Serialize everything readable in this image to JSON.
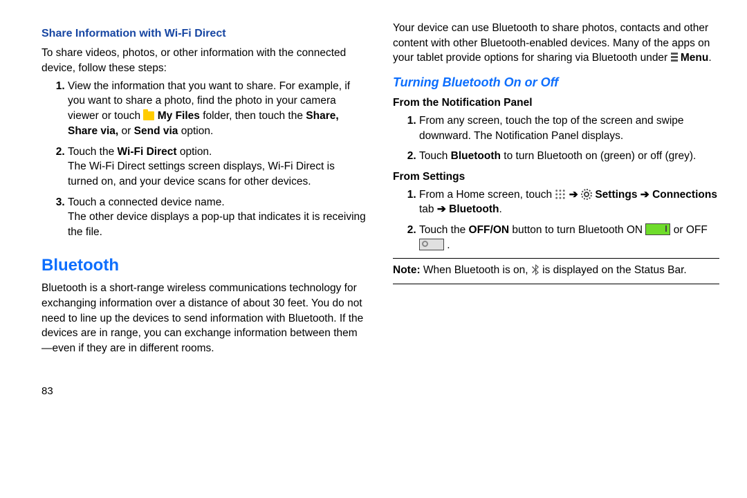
{
  "left": {
    "h_share": "Share Information with Wi-Fi Direct",
    "intro": "To share videos, photos, or other information with the connected device, follow these steps:",
    "step1_a": "View the information that you want to share. For example, if you want to share a photo, find the photo in your camera viewer or touch ",
    "step1_myfiles": " My Files",
    "step1_b": " folder, then touch the ",
    "step1_bold": "Share, Share via,",
    "step1_or": " or ",
    "step1_sendvia": "Send via",
    "step1_c": " option.",
    "step2_a": "Touch the ",
    "step2_bold": "Wi-Fi Direct",
    "step2_b": " option.",
    "step2_p": "The Wi-Fi Direct settings screen displays, Wi-Fi Direct is turned on, and your device scans for other devices.",
    "step3_a": "Touch a connected device name.",
    "step3_p": "The other device displays a pop-up that indicates it is receiving the file.",
    "h_bt": "Bluetooth",
    "bt_p": "Bluetooth is a short-range wireless communications technology for exchanging information over a distance of about 30 feet. You do not need to line up the devices to send information with Bluetooth. If the devices are in range, you can exchange information between them—even if they are in different rooms.",
    "page": "83"
  },
  "right": {
    "top_a": "Your device can use Bluetooth to share photos, contacts and other content with other Bluetooth-enabled devices. Many of the apps on your tablet provide options for sharing via Bluetooth under ",
    "top_menu": " Menu",
    "h_turn": "Turning Bluetooth On or Off",
    "h_notif": "From the Notification Panel",
    "n1": "From any screen, touch the top of the screen and swipe downward. The Notification Panel displays.",
    "n2_a": "Touch ",
    "n2_bt": "Bluetooth",
    "n2_b": " to turn Bluetooth on (green) or off (grey).",
    "h_settings": "From Settings",
    "s1_a": "From a Home screen, touch ",
    "s1_arrow": " ➔ ",
    "s1_settings": " Settings ➔ Connections",
    "s1_tab": " tab ",
    "s1_arrow2": "➔ ",
    "s1_bt": "Bluetooth",
    "s2_a": "Touch the ",
    "s2_offon": "OFF/ON",
    "s2_b": " button to turn Bluetooth ON ",
    "s2_c": " or OFF ",
    "note_a": "Note:",
    "note_b": " When Bluetooth is on, ",
    "note_c": " is displayed on the Status Bar."
  }
}
